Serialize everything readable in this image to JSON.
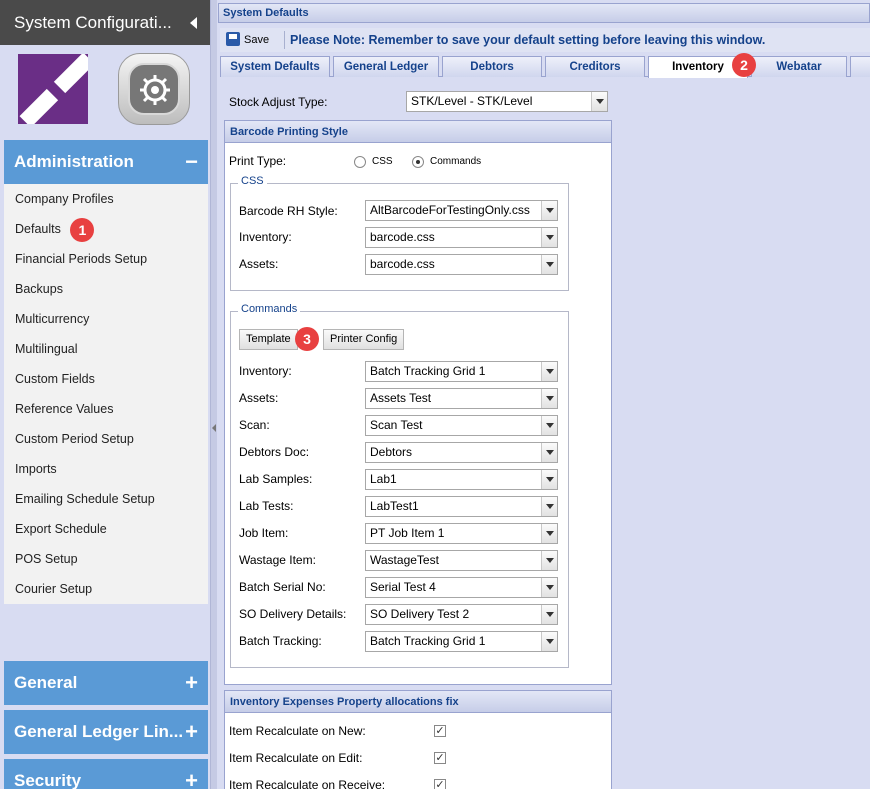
{
  "sidebar": {
    "title": "System Configurati...",
    "admin_header": "Administration",
    "admin_toggle": "−",
    "items": [
      {
        "label": "Company Profiles"
      },
      {
        "label": "Defaults",
        "badge": "1"
      },
      {
        "label": "Financial Periods Setup"
      },
      {
        "label": "Backups"
      },
      {
        "label": "Multicurrency"
      },
      {
        "label": "Multilingual"
      },
      {
        "label": "Custom Fields"
      },
      {
        "label": "Reference Values"
      },
      {
        "label": "Custom Period Setup"
      },
      {
        "label": "Imports"
      },
      {
        "label": "Emailing Schedule Setup"
      },
      {
        "label": "Export Schedule"
      },
      {
        "label": "POS Setup"
      },
      {
        "label": "Courier Setup"
      }
    ],
    "collapsed": [
      {
        "label": "General",
        "toggle": "+"
      },
      {
        "label": "General Ledger Lin...",
        "toggle": "+"
      },
      {
        "label": "Security",
        "toggle": "+"
      }
    ]
  },
  "main": {
    "window_title": "System Defaults",
    "save_label": "Save",
    "note": "Please Note: Remember to save your default setting before leaving this window.",
    "tabs": [
      {
        "label": "System Defaults"
      },
      {
        "label": "General Ledger"
      },
      {
        "label": "Debtors"
      },
      {
        "label": "Creditors"
      },
      {
        "label": "Inventory",
        "active": true
      },
      {
        "label": "Webatar"
      }
    ],
    "tab_badge": "2",
    "stock_adjust": {
      "label": "Stock Adjust Type:",
      "value": "STK/Level - STK/Level"
    },
    "barcode": {
      "title": "Barcode Printing Style",
      "print_type_label": "Print Type:",
      "options": [
        {
          "label": "CSS",
          "selected": false
        },
        {
          "label": "Commands",
          "selected": true
        }
      ],
      "css": {
        "legend": "CSS",
        "fields": [
          {
            "label": "Barcode RH Style:",
            "value": "AltBarcodeForTestingOnly.css"
          },
          {
            "label": "Inventory:",
            "value": "barcode.css"
          },
          {
            "label": "Assets:",
            "value": "barcode.css"
          }
        ]
      },
      "commands": {
        "legend": "Commands",
        "template_label": "Template",
        "template_badge": "3",
        "printer_config_label": "Printer Config",
        "fields": [
          {
            "label": "Inventory:",
            "value": "Batch Tracking Grid 1"
          },
          {
            "label": "Assets:",
            "value": "Assets Test"
          },
          {
            "label": "Scan:",
            "value": "Scan Test"
          },
          {
            "label": "Debtors Doc:",
            "value": "Debtors"
          },
          {
            "label": "Lab Samples:",
            "value": "Lab1"
          },
          {
            "label": "Lab Tests:",
            "value": "LabTest1"
          },
          {
            "label": "Job Item:",
            "value": "PT Job Item 1"
          },
          {
            "label": "Wastage Item:",
            "value": "WastageTest"
          },
          {
            "label": "Batch Serial No:",
            "value": "Serial Test 4"
          },
          {
            "label": "SO Delivery Details:",
            "value": "SO Delivery Test 2"
          },
          {
            "label": "Batch Tracking:",
            "value": "Batch Tracking Grid 1"
          }
        ]
      }
    },
    "expenses": {
      "title": "Inventory Expenses Property allocations fix",
      "items": [
        {
          "label": "Item Recalculate on New:",
          "checked": true
        },
        {
          "label": "Item Recalculate on Edit:",
          "checked": true
        },
        {
          "label": "Item Recalculate on Receive:",
          "checked": true
        }
      ]
    }
  }
}
